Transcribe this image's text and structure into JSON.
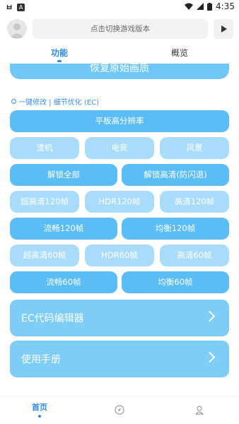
{
  "status_bar": {
    "time": "4:35"
  },
  "header": {
    "version_placeholder": "点击切换游戏版本"
  },
  "tabs": [
    "功能",
    "概览"
  ],
  "restore_button": "恢复原始画质",
  "section_title": "一键修改 | 细节优化 (EC)",
  "buttons": {
    "tablet_hd": "平板高分辨率",
    "preset_row": [
      "渣机",
      "电竞",
      "风景"
    ],
    "unlock_all": "解锁全部",
    "unlock_hd": "解锁高清(防闪退)",
    "fps120_row": [
      "超高清120帧",
      "HDR120帧",
      "高清120帧"
    ],
    "smooth120": "流畅120帧",
    "balanced120": "均衡120帧",
    "fps60_row": [
      "超高清60帧",
      "HDR60帧",
      "高清60帧"
    ],
    "smooth60": "流畅60帧",
    "balanced60": "均衡60帧"
  },
  "menu_cards": [
    "EC代码编辑器",
    "使用手册"
  ],
  "bottom_nav": {
    "home_label": "首页"
  },
  "colors": {
    "accent": "#2f8cde",
    "button_dark": "#5abdf6",
    "button_light": "#a9dcfa"
  }
}
